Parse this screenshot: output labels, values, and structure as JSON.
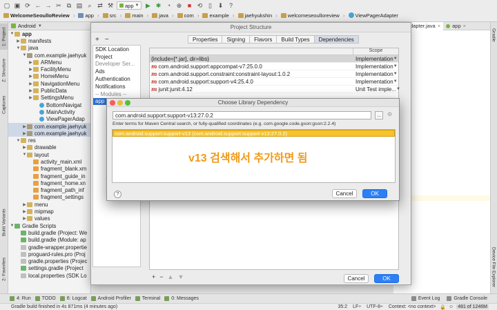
{
  "toolbar": {
    "run_config": "app",
    "crumbs": [
      "WelcomeSeoulloReview",
      "app",
      "src",
      "main",
      "java",
      "com",
      "example",
      "jaehyukshin",
      "welcomeseoulloreview",
      "ViewPagerAdapter"
    ]
  },
  "left_strip": {
    "project": "1: Project",
    "structure": "Z: Structure",
    "captures": "Captures",
    "build_variants": "Build Variants",
    "favorites": "2: Favorites"
  },
  "right_strip": {
    "gradle": "Gradle",
    "device_explorer": "Device File Explorer"
  },
  "project_panel": {
    "view_mode": "Android",
    "items": [
      {
        "label": "app",
        "depth": 0,
        "arrow": "▼",
        "icon": "fold",
        "bold": true
      },
      {
        "label": "manifests",
        "depth": 1,
        "arrow": "▶",
        "icon": "fold"
      },
      {
        "label": "java",
        "depth": 1,
        "arrow": "▼",
        "icon": "fold"
      },
      {
        "label": "com.example.jaehyuk",
        "depth": 2,
        "arrow": "▼",
        "icon": "pkg"
      },
      {
        "label": "ARMenu",
        "depth": 3,
        "arrow": "▶",
        "icon": "fold"
      },
      {
        "label": "FacilityMenu",
        "depth": 3,
        "arrow": "▶",
        "icon": "fold"
      },
      {
        "label": "HomeMenu",
        "depth": 3,
        "arrow": "▶",
        "icon": "fold"
      },
      {
        "label": "NavigationMenu",
        "depth": 3,
        "arrow": "▶",
        "icon": "fold"
      },
      {
        "label": "PublicData",
        "depth": 3,
        "arrow": "▶",
        "icon": "fold"
      },
      {
        "label": "SettingsMenu",
        "depth": 3,
        "arrow": "▶",
        "icon": "fold"
      },
      {
        "label": "BottomNavigat",
        "depth": 4,
        "arrow": "",
        "icon": "cls"
      },
      {
        "label": "MainActivity",
        "depth": 4,
        "arrow": "",
        "icon": "cls"
      },
      {
        "label": "ViewPagerAdap",
        "depth": 4,
        "arrow": "",
        "icon": "cls"
      },
      {
        "label": "com.example.jaehyuk",
        "depth": 2,
        "arrow": "▶",
        "icon": "pkg",
        "sel": true
      },
      {
        "label": "com.example.jaehyuk",
        "depth": 2,
        "arrow": "▶",
        "icon": "pkg",
        "sel": true
      },
      {
        "label": "res",
        "depth": 1,
        "arrow": "▼",
        "icon": "fold"
      },
      {
        "label": "drawable",
        "depth": 2,
        "arrow": "▶",
        "icon": "fold"
      },
      {
        "label": "layout",
        "depth": 2,
        "arrow": "▼",
        "icon": "fold"
      },
      {
        "label": "activity_main.xml",
        "depth": 3,
        "arrow": "",
        "icon": "xml"
      },
      {
        "label": "fragment_blank.xm",
        "depth": 3,
        "arrow": "",
        "icon": "xml"
      },
      {
        "label": "fragment_guide_in",
        "depth": 3,
        "arrow": "",
        "icon": "xml"
      },
      {
        "label": "fragment_home.xn",
        "depth": 3,
        "arrow": "",
        "icon": "xml"
      },
      {
        "label": "fragment_path_inf",
        "depth": 3,
        "arrow": "",
        "icon": "xml"
      },
      {
        "label": "fragment_settings",
        "depth": 3,
        "arrow": "",
        "icon": "xml"
      },
      {
        "label": "menu",
        "depth": 2,
        "arrow": "▶",
        "icon": "fold"
      },
      {
        "label": "mipmap",
        "depth": 2,
        "arrow": "▶",
        "icon": "fold"
      },
      {
        "label": "values",
        "depth": 2,
        "arrow": "▶",
        "icon": "fold"
      },
      {
        "label": "Gradle Scripts",
        "depth": 0,
        "arrow": "▼",
        "icon": "gr"
      },
      {
        "label": "build.gradle (Project: We",
        "depth": 1,
        "arrow": "",
        "icon": "gr"
      },
      {
        "label": "build.gradle (Module: ap",
        "depth": 1,
        "arrow": "",
        "icon": "gr"
      },
      {
        "label": "gradle-wrapper.propertie",
        "depth": 1,
        "arrow": "",
        "icon": "file"
      },
      {
        "label": "proguard-rules.pro (Proj",
        "depth": 1,
        "arrow": "",
        "icon": "file"
      },
      {
        "label": "gradle.properties (Projec",
        "depth": 1,
        "arrow": "",
        "icon": "file"
      },
      {
        "label": "settings.gradle (Project",
        "depth": 1,
        "arrow": "",
        "icon": "gr"
      },
      {
        "label": "local.properties (SDK Lo",
        "depth": 1,
        "arrow": "",
        "icon": "file"
      }
    ]
  },
  "editor_tabs": [
    {
      "label": "agerAdapter.java"
    },
    {
      "label": "app"
    }
  ],
  "project_structure": {
    "title": "Project Structure",
    "sidebar": [
      {
        "label": "SDK Location"
      },
      {
        "label": "Project"
      },
      {
        "label": "Developer Ser...",
        "grey": true
      },
      {
        "label": "Ads"
      },
      {
        "label": "Authentication"
      },
      {
        "label": "Notifications"
      },
      {
        "label": "-- Modules --",
        "grey": true
      },
      {
        "label": "app",
        "sel": true
      }
    ],
    "tabs": [
      {
        "label": "Properties"
      },
      {
        "label": "Signing"
      },
      {
        "label": "Flavors"
      },
      {
        "label": "Build Types"
      },
      {
        "label": "Dependencies",
        "active": true
      }
    ],
    "scope_header": "Scope",
    "dependencies": [
      {
        "name": "{include=[*.jar], dir=libs}",
        "scope": "Implementation",
        "icon": false,
        "sel": true
      },
      {
        "name": "com.android.support:appcompat-v7:25.0.0",
        "scope": "Implementation",
        "icon": true
      },
      {
        "name": "com.android.support.constraint:constraint-layout:1.0.2",
        "scope": "Implementation",
        "icon": true
      },
      {
        "name": "com.android.support:support-v4:25.4.0",
        "scope": "Implementation",
        "icon": true
      },
      {
        "name": "junit:junit:4.12",
        "scope": "Unit Test imple...",
        "icon": true
      }
    ],
    "cancel_label": "Cancel",
    "ok_label": "OK"
  },
  "choose_dependency": {
    "title": "Choose Library Dependency",
    "search_value": "com.android.support:support-v13:27.0.2",
    "browse_label": "...",
    "hint": "Enter terms for Maven Central search, or fully-qualified coordinates (e.g. com.google.code.gson:gson:2.2.4)",
    "result": "com.android.support:support-v13 (com.android.support:support-v13:27.0.2)",
    "annotation": "v13 검색해서 추가하면 됨",
    "help_label": "?",
    "cancel_label": "Cancel",
    "ok_label": "OK"
  },
  "bottom_tools": [
    {
      "label": "4: Run"
    },
    {
      "label": "TODO"
    },
    {
      "label": "6: Logcat"
    },
    {
      "label": "Android Profiler"
    },
    {
      "label": "Terminal"
    },
    {
      "label": "0: Messages"
    }
  ],
  "bottom_tools_right": [
    {
      "label": "Event Log"
    },
    {
      "label": "Gradle Console"
    }
  ],
  "status": {
    "message": "Gradle build finished in 4s 871ms (4 minutes ago)",
    "position": "35:2",
    "line_sep": "LF÷",
    "encoding": "UTF-8÷",
    "context": "Context: <no context>",
    "memory": "481 of 1246M"
  }
}
